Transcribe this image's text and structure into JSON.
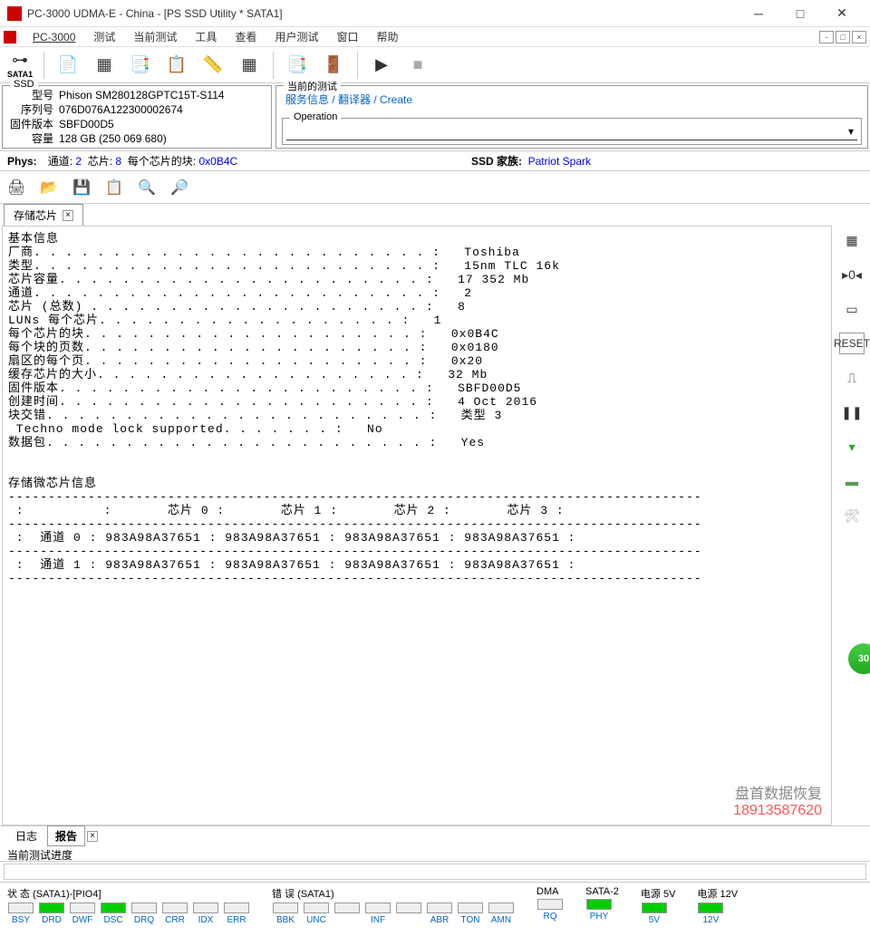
{
  "titlebar": {
    "title": "PC-3000 UDMA-E - China - [PS SSD Utility * SATA1]"
  },
  "menubar": {
    "items": [
      "PC-3000",
      "测试",
      "当前测试",
      "工具",
      "查看",
      "用户测试",
      "窗口",
      "帮助"
    ]
  },
  "toolbar_sata": "SATA1",
  "ssd_panel": {
    "title": "SSD",
    "model_label": "型号",
    "model": "Phison SM280128GPTC15T-S114",
    "serial_label": "序列号",
    "serial": "076D076A122300002674",
    "firmware_label": "固件版本",
    "firmware": "SBFD00D5",
    "capacity_label": "容量",
    "capacity": "128 GB (250 069 680)"
  },
  "test_panel": {
    "title": "当前的测试",
    "links": "服务信息 / 翻译器 / Create",
    "operation_title": "Operation"
  },
  "phys_row": {
    "phys": "Phys:",
    "channel_label": "通道:",
    "channel": "2",
    "chip_label": "芯片:",
    "chip": "8",
    "blocks_label": "每个芯片的块:",
    "blocks": "0x0B4C",
    "ssd_family_label": "SSD 家族:",
    "ssd_family": "Patriot Spark"
  },
  "tab": {
    "label": "存储芯片"
  },
  "content_text": "基本信息\n厂商. . . . . . . . . . . . . . . . . . . . . . . . . :   Toshiba\n类型. . . . . . . . . . . . . . . . . . . . . . . . . :   15nm TLC 16k\n芯片容量. . . . . . . . . . . . . . . . . . . . . . . :   17 352 Mb\n通道. . . . . . . . . . . . . . . . . . . . . . . . . :   2\n芯片 (总数) . . . . . . . . . . . . . . . . . . . . . :   8\nLUNs 每个芯片. . . . . . . . . . . . . . . . . . . :   1\n每个芯片的块. . . . . . . . . . . . . . . . . . . . . :   0x0B4C\n每个块的页数. . . . . . . . . . . . . . . . . . . . . :   0x0180\n扇区的每个页. . . . . . . . . . . . . . . . . . . . . :   0x20\n缓存芯片的大小. . . . . . . . . . . . . . . . . . . . :   32 Mb\n固件版本. . . . . . . . . . . . . . . . . . . . . . . :   SBFD00D5\n创建时间. . . . . . . . . . . . . . . . . . . . . . . :   4 Oct 2016\n块交错. . . . . . . . . . . . . . . . . . . . . . . . :   类型 3\n Techno mode lock supported. . . . . . . :   No\n数据包. . . . . . . . . . . . . . . . . . . . . . . . :   Yes\n\n\n存储微芯片信息\n---------------------------------------------------------------------------------------\n :          :       芯片 0 :       芯片 1 :       芯片 2 :       芯片 3 :\n---------------------------------------------------------------------------------------\n :  通道 0 : 983A98A37651 : 983A98A37651 : 983A98A37651 : 983A98A37651 :\n---------------------------------------------------------------------------------------\n :  通道 1 : 983A98A37651 : 983A98A37651 : 983A98A37651 : 983A98A37651 :\n---------------------------------------------------------------------------------------",
  "watermark": {
    "text": "盘首数据恢复",
    "phone": "18913587620"
  },
  "reset_label": "RESET",
  "round_badge": "30",
  "bottom_tabs": {
    "log": "日志",
    "report": "报告"
  },
  "progress_label": "当前测试进度",
  "status": {
    "state_title": "状 态 (SATA1)-[PIO4]",
    "state_leds": [
      {
        "label": "BSY",
        "on": false
      },
      {
        "label": "DRD",
        "on": true
      },
      {
        "label": "DWF",
        "on": false
      },
      {
        "label": "DSC",
        "on": true
      },
      {
        "label": "DRQ",
        "on": false
      },
      {
        "label": "CRR",
        "on": false
      },
      {
        "label": "IDX",
        "on": false
      },
      {
        "label": "ERR",
        "on": false
      }
    ],
    "error_title": "错 误 (SATA1)",
    "error_leds": [
      {
        "label": "BBK",
        "on": false
      },
      {
        "label": "UNC",
        "on": false
      },
      {
        "label": "",
        "on": false
      },
      {
        "label": "INF",
        "on": false
      },
      {
        "label": "",
        "on": false
      },
      {
        "label": "ABR",
        "on": false
      },
      {
        "label": "TON",
        "on": false
      },
      {
        "label": "AMN",
        "on": false
      }
    ],
    "dma_title": "DMA",
    "dma_leds": [
      {
        "label": "RQ",
        "on": false
      }
    ],
    "sata2_title": "SATA-2",
    "sata2_leds": [
      {
        "label": "PHY",
        "on": true
      }
    ],
    "pwr5_title": "电源 5V",
    "pwr5_leds": [
      {
        "label": "5V",
        "on": true
      }
    ],
    "pwr12_title": "电源 12V",
    "pwr12_leds": [
      {
        "label": "12V",
        "on": true
      }
    ]
  }
}
